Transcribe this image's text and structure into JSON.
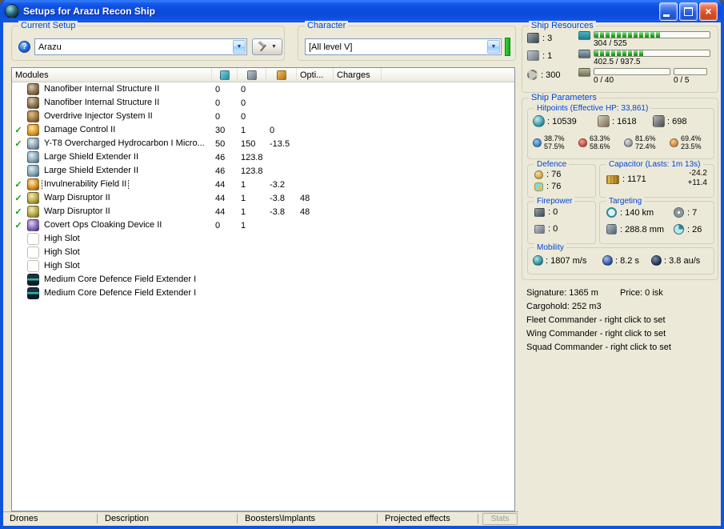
{
  "window": {
    "title": "Setups for Arazu Recon Ship"
  },
  "icons": {
    "help_glyph": "?",
    "dropdown_arrow": "▼",
    "close_glyph": "×",
    "check_glyph": "✓"
  },
  "current_setup": {
    "label": "Current Setup",
    "selected": "Arazu"
  },
  "character": {
    "label": "Character",
    "selected": "[All level V]"
  },
  "modules": {
    "columns": {
      "name": "Modules",
      "opti": "Opti...",
      "charges": "Charges"
    },
    "rows": [
      {
        "check": false,
        "selected": false,
        "icon": "nanofiber-structure",
        "name": "Nanofiber Internal Structure II",
        "cpu": "0",
        "pg": "0",
        "cap": "",
        "opti": "",
        "charges": ""
      },
      {
        "check": false,
        "selected": false,
        "icon": "nanofiber-structure",
        "name": "Nanofiber Internal Structure II",
        "cpu": "0",
        "pg": "0",
        "cap": "",
        "opti": "",
        "charges": ""
      },
      {
        "check": false,
        "selected": false,
        "icon": "overdrive-injector",
        "name": "Overdrive Injector System II",
        "cpu": "0",
        "pg": "0",
        "cap": "",
        "opti": "",
        "charges": ""
      },
      {
        "check": true,
        "selected": false,
        "icon": "damage-control",
        "name": "Damage Control II",
        "cpu": "30",
        "pg": "1",
        "cap": "0",
        "opti": "",
        "charges": ""
      },
      {
        "check": true,
        "selected": false,
        "icon": "microwarpdrive",
        "name": "Y-T8 Overcharged Hydrocarbon I Micro...",
        "cpu": "50",
        "pg": "150",
        "cap": "-13.5",
        "opti": "",
        "charges": ""
      },
      {
        "check": false,
        "selected": false,
        "icon": "shield-extender",
        "name": "Large Shield Extender II",
        "cpu": "46",
        "pg": "123.8",
        "cap": "",
        "opti": "",
        "charges": ""
      },
      {
        "check": false,
        "selected": false,
        "icon": "shield-extender",
        "name": "Large Shield Extender II",
        "cpu": "46",
        "pg": "123.8",
        "cap": "",
        "opti": "",
        "charges": ""
      },
      {
        "check": true,
        "selected": true,
        "icon": "invulnerability-field",
        "name": "Invulnerability Field II",
        "cpu": "44",
        "pg": "1",
        "cap": "-3.2",
        "opti": "",
        "charges": ""
      },
      {
        "check": true,
        "selected": false,
        "icon": "warp-disruptor",
        "name": "Warp Disruptor II",
        "cpu": "44",
        "pg": "1",
        "cap": "-3.8",
        "opti": "48",
        "charges": ""
      },
      {
        "check": true,
        "selected": false,
        "icon": "warp-disruptor",
        "name": "Warp Disruptor II",
        "cpu": "44",
        "pg": "1",
        "cap": "-3.8",
        "opti": "48",
        "charges": ""
      },
      {
        "check": true,
        "selected": false,
        "icon": "cloaking-device",
        "name": "Covert Ops Cloaking Device II",
        "cpu": "0",
        "pg": "1",
        "cap": "",
        "opti": "",
        "charges": ""
      },
      {
        "check": false,
        "selected": false,
        "icon": "empty-high-slot",
        "name": "High Slot",
        "cpu": "",
        "pg": "",
        "cap": "",
        "opti": "",
        "charges": ""
      },
      {
        "check": false,
        "selected": false,
        "icon": "empty-high-slot",
        "name": "High Slot",
        "cpu": "",
        "pg": "",
        "cap": "",
        "opti": "",
        "charges": ""
      },
      {
        "check": false,
        "selected": false,
        "icon": "empty-high-slot",
        "name": "High Slot",
        "cpu": "",
        "pg": "",
        "cap": "",
        "opti": "",
        "charges": ""
      },
      {
        "check": false,
        "selected": false,
        "icon": "shield-rig",
        "name": "Medium Core Defence Field Extender I",
        "cpu": "",
        "pg": "",
        "cap": "",
        "opti": "",
        "charges": ""
      },
      {
        "check": false,
        "selected": false,
        "icon": "shield-rig",
        "name": "Medium Core Defence Field Extender I",
        "cpu": "",
        "pg": "",
        "cap": "",
        "opti": "",
        "charges": ""
      }
    ]
  },
  "ship_resources": {
    "label": "Ship Resources",
    "turret_hardpoints": ": 3",
    "launcher_hardpoints": ": 1",
    "calibration": ": 300",
    "cpu": {
      "text": "304 / 525",
      "pct": 58
    },
    "powergrid": {
      "text": "402.5 / 937.5",
      "pct": 43
    },
    "dronebay": {
      "text": "0 / 40",
      "pct": 0
    },
    "drones": {
      "text": "0 / 5",
      "pct": 0
    }
  },
  "ship_parameters": {
    "label": "Ship Parameters",
    "hitpoints": {
      "label": "Hitpoints (Effective HP: 33,861)",
      "shield": ": 10539",
      "armor": ": 1618",
      "structure": ": 698",
      "resists": [
        {
          "shield": "38.7%",
          "armor": "57.5%"
        },
        {
          "shield": "63.3%",
          "armor": "58.6%"
        },
        {
          "shield": "81.6%",
          "armor": "72.4%"
        },
        {
          "shield": "69.4%",
          "armor": "23.5%"
        }
      ]
    },
    "defence": {
      "label": "Defence",
      "top": ": 76",
      "bottom": ": 76"
    },
    "capacitor": {
      "label": "Capacitor (Lasts: 1m 13s)",
      "amount": ": 1171",
      "usage": "-24.2",
      "recharge": "+11.4"
    },
    "firepower": {
      "label": "Firepower",
      "turret": ": 0",
      "missile": ": 0"
    },
    "targeting": {
      "label": "Targeting",
      "range": ": 140 km",
      "max_targets": ": 7",
      "scan_resolution": ": 288.8 mm",
      "sensor_strength": ": 26"
    },
    "mobility": {
      "label": "Mobility",
      "speed": ": 1807 m/s",
      "align_time": ": 8.2 s",
      "warp_speed": ": 3.8 au/s"
    }
  },
  "info": {
    "signature": "Signature: 1365 m",
    "price": "Price: 0 isk",
    "cargohold": "Cargohold: 252 m3",
    "fleet_commander": "Fleet Commander - right click to set",
    "wing_commander": "Wing Commander - right click to set",
    "squad_commander": "Squad Commander - right click to set"
  },
  "bottom_tabs": {
    "drones": "Drones",
    "description": "Description",
    "boosters_implants": "Boosters\\Implants",
    "projected_effects": "Projected effects",
    "stats": "Stats"
  }
}
